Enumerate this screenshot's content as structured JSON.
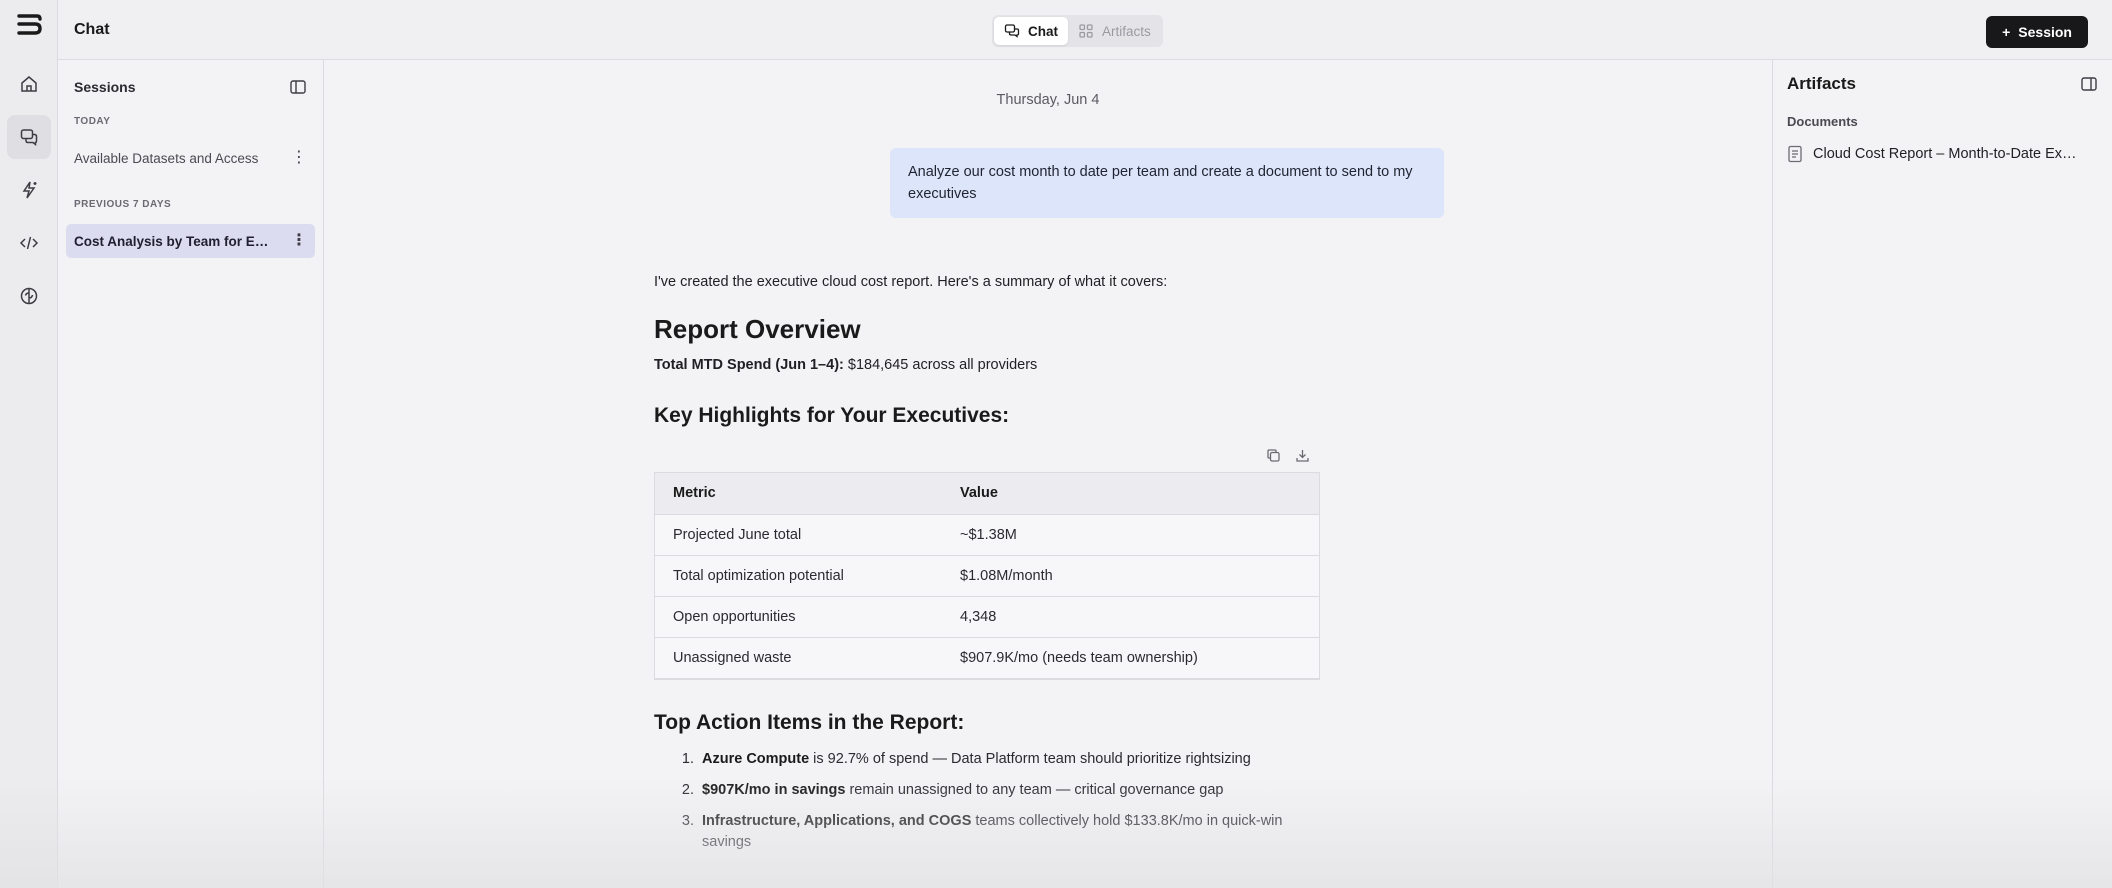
{
  "window": {
    "title": "Chat"
  },
  "rail": {
    "items": [
      {
        "icon": "home-icon"
      },
      {
        "icon": "chat-icon",
        "active": true
      },
      {
        "icon": "sparkle-icon"
      },
      {
        "icon": "code-icon"
      },
      {
        "icon": "brain-icon"
      }
    ]
  },
  "view_toggle": {
    "chat_label": "Chat",
    "artifacts_label": "Artifacts",
    "active": "Chat"
  },
  "new_session": {
    "label": "Session"
  },
  "sessions": {
    "title": "Sessions",
    "groups": [
      {
        "label": "TODAY",
        "items": [
          {
            "label": "Available Datasets and Access"
          }
        ]
      },
      {
        "label": "PREVIOUS 7 DAYS",
        "items": [
          {
            "label": "Cost Analysis by Team for Executives",
            "active": true
          }
        ]
      }
    ]
  },
  "chat": {
    "date": "Thursday, Jun 4",
    "user_message": "Analyze our cost month to date per team and create a document to send to my executives",
    "reply": {
      "intro": "I've created the executive cloud cost report. Here's a summary of what it covers:",
      "heading": "Report Overview",
      "total_label": "Total MTD Spend (Jun 1–4):",
      "total_value": "$184,645 across all providers",
      "highlights_heading": "Key Highlights for Your Executives:",
      "table": {
        "headers": [
          "Metric",
          "Value"
        ],
        "rows": [
          [
            "Projected June total",
            "~$1.38M"
          ],
          [
            "Total optimization potential",
            "$1.08M/month"
          ],
          [
            "Open opportunities",
            "4,348"
          ],
          [
            "Unassigned waste",
            "$907.9K/mo (needs team ownership)"
          ]
        ]
      },
      "actions_heading": "Top Action Items in the Report:",
      "actions": [
        {
          "bold": "Azure Compute",
          "rest": " is 92.7% of spend — Data Platform team should prioritize rightsizing"
        },
        {
          "bold": "$907K/mo in savings",
          "rest": " remain unassigned to any team — critical governance gap"
        },
        {
          "bold": "Infrastructure, Applications, and COGS",
          "rest": " teams collectively hold $133.8K/mo in quick-win savings"
        }
      ]
    }
  },
  "artifacts": {
    "title": "Artifacts",
    "section_label": "Documents",
    "documents": [
      {
        "name": "Cloud Cost Report – Month-to-Date Executive Summary"
      }
    ]
  },
  "colors": {
    "accent_bubble": "#dde5fb",
    "primary_button": "#18181b",
    "active_session": "#dcdcf0"
  }
}
